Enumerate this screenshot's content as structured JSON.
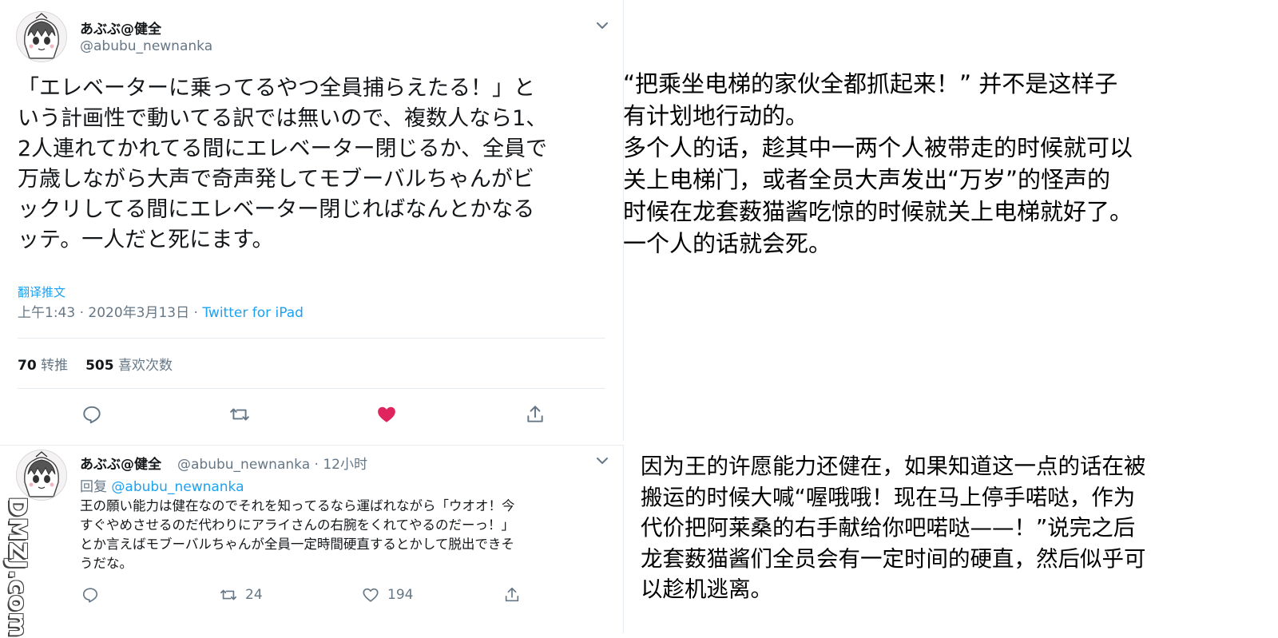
{
  "tweet": {
    "author_name": "あぶぶ@健全",
    "author_handle": "@abubu_newnanka",
    "lines": [
      "「エレベーターに乗ってるやつ全員捕らえたる！」と",
      "いう計画性で動いてる訳では無いので、複数人なら1、",
      "2人連れてかれてる間にエレベーター閉じるか、全員で",
      "万歳しながら大声で奇声発してモブーバルちゃんがビ",
      "ックリしてる間にエレベーター閉じればなんとかなる",
      "ッテ。一人だと死にます。"
    ],
    "translate_label": "翻译推文",
    "time": "上午1:43",
    "date": "2020年3月13日",
    "separator": "·",
    "source": "Twitter for iPad",
    "retweets_count": "70",
    "retweets_label": "转推",
    "likes_count": "505",
    "likes_label": "喜欢次数",
    "liked": true,
    "colors": {
      "link": "#1da1f2",
      "like": "#e0245e",
      "muted": "#657786"
    }
  },
  "reply": {
    "author_name": "あぶぶ@健全",
    "author_handle": "@abubu_newnanka",
    "age": "12小时",
    "reply_prefix": "回复",
    "reply_mention": "@abubu_newnanka",
    "lines": [
      "王の願い能力は健在なのでそれを知ってるなら運ばれながら「ウオオ！今",
      "すぐやめさせるのだ代わりにアライさんの右腕をくれてやるのだーっ！」",
      "とか言えばモブーバルちゃんが全員一定時間硬直するとかして脱出できそ",
      "うだな。"
    ],
    "retweets_count": "24",
    "likes_count": "194"
  },
  "translation_1": {
    "lines": [
      "“把乘坐电梯的家伙全都抓起来！” 并不是这样子",
      "有计划地行动的。",
      "多个人的话，趁其中一两个人被带走的时候就可以",
      "关上电梯门，或者全员大声发出“万岁”的怪声的",
      "时候在龙套薮猫酱吃惊的时候就关上电梯就好了。",
      "一个人的话就会死。"
    ]
  },
  "translation_2": {
    "lines": [
      "因为王的许愿能力还健在，如果知道这一点的话在被",
      "搬运的时候大喊“喔哦哦！现在马上停手喏哒，作为",
      "代价把阿莱桑的右手献给你吧喏哒——！”说完之后",
      "龙套薮猫酱们全员会有一定时间的硬直，然后似乎可",
      "以趁机逃离。"
    ]
  },
  "watermark": {
    "text": "DMZJ.com"
  },
  "icons": [
    "avatar",
    "chevron-down-icon",
    "reply-icon",
    "retweet-icon",
    "heart-icon",
    "share-icon"
  ]
}
